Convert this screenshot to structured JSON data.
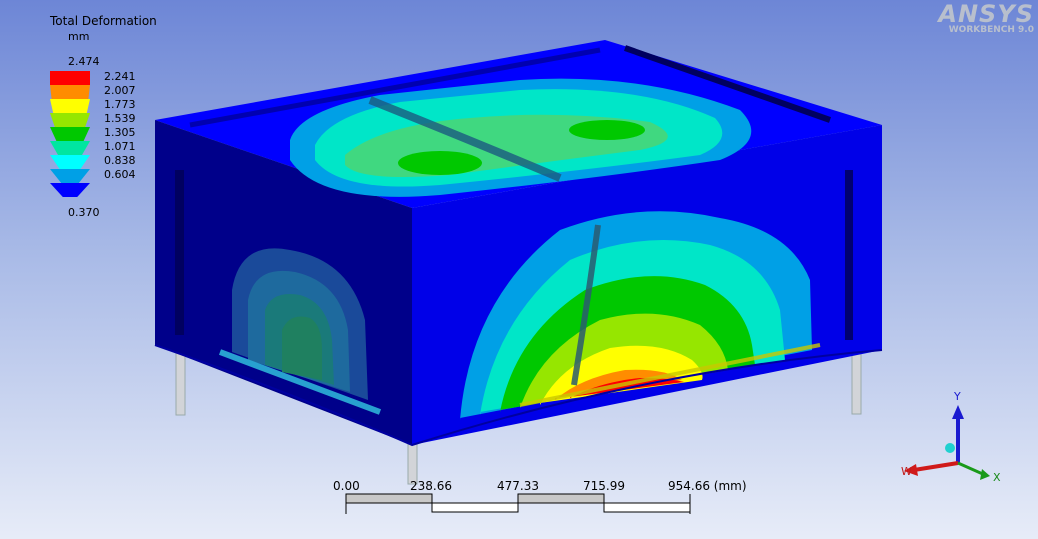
{
  "legend": {
    "title": "Total Deformation",
    "unit": "mm",
    "max": "2.474",
    "min": "0.370",
    "bands": [
      {
        "label": "2.241",
        "color": "#ff0000"
      },
      {
        "label": "2.007",
        "color": "#ff8c00"
      },
      {
        "label": "1.773",
        "color": "#ffff00"
      },
      {
        "label": "1.539",
        "color": "#96e600"
      },
      {
        "label": "1.305",
        "color": "#00c800"
      },
      {
        "label": "1.071",
        "color": "#00e6a0"
      },
      {
        "label": "0.838",
        "color": "#00ffff"
      },
      {
        "label": "0.604",
        "color": "#00a0e6"
      },
      {
        "label": "",
        "color": "#0000ff"
      }
    ]
  },
  "brand": {
    "logo": "ANSYS",
    "subtitle": "WORKBENCH 9.0"
  },
  "scale": {
    "ticks": [
      "0.00",
      "238.66",
      "477.33",
      "715.99",
      "954.66 (mm)"
    ]
  },
  "triad": {
    "x": "X",
    "y": "Y",
    "w": "W"
  },
  "colors": {
    "body": "#0000ff",
    "front_face": "#000080",
    "left_face": "#0a0ac8",
    "legs": "#c8c8c8"
  }
}
